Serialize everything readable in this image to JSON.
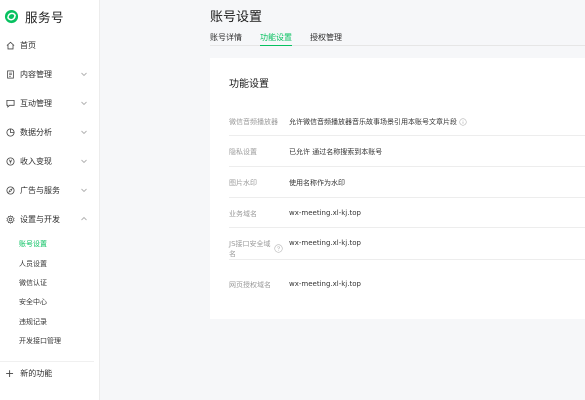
{
  "brand": {
    "name": "服务号",
    "logo_icon": "wechat-service-logo-icon",
    "accent": "#07c160"
  },
  "sidebar": {
    "items": [
      {
        "label": "首页",
        "icon": "home-icon",
        "expandable": false
      },
      {
        "label": "内容管理",
        "icon": "document-icon",
        "expandable": true
      },
      {
        "label": "互动管理",
        "icon": "chat-icon",
        "expandable": true
      },
      {
        "label": "数据分析",
        "icon": "pie-chart-icon",
        "expandable": true
      },
      {
        "label": "收入变现",
        "icon": "yen-icon",
        "expandable": true
      },
      {
        "label": "广告与服务",
        "icon": "compass-icon",
        "expandable": true
      },
      {
        "label": "设置与开发",
        "icon": "gear-icon",
        "expandable": true,
        "expanded": true
      }
    ],
    "subitems": [
      {
        "label": "账号设置",
        "active": true
      },
      {
        "label": "人员设置"
      },
      {
        "label": "微信认证"
      },
      {
        "label": "安全中心"
      },
      {
        "label": "违规记录"
      },
      {
        "label": "开发接口管理"
      }
    ],
    "new_feature": "新的功能"
  },
  "header": {
    "title": "账号设置"
  },
  "tabs": [
    {
      "label": "账号详情"
    },
    {
      "label": "功能设置",
      "active": true
    },
    {
      "label": "授权管理"
    }
  ],
  "card": {
    "title": "功能设置",
    "rows": [
      {
        "key": "微信音频播放器",
        "value": "允许微信音频播放器音乐故事场景引用本账号文章片段",
        "info": true
      },
      {
        "key": "隐私设置",
        "value": "已允许 通过名称搜索到本账号"
      },
      {
        "key": "图片水印",
        "value": "使用名称作为水印"
      },
      {
        "key": "业务域名",
        "value": "wx-meeting.xl-kj.top"
      },
      {
        "key_line1": "JS接口安全域",
        "key_line2": "名",
        "value": "wx-meeting.xl-kj.top",
        "help": true
      },
      {
        "key": "网页授权域名",
        "value": "wx-meeting.xl-kj.top"
      }
    ]
  }
}
